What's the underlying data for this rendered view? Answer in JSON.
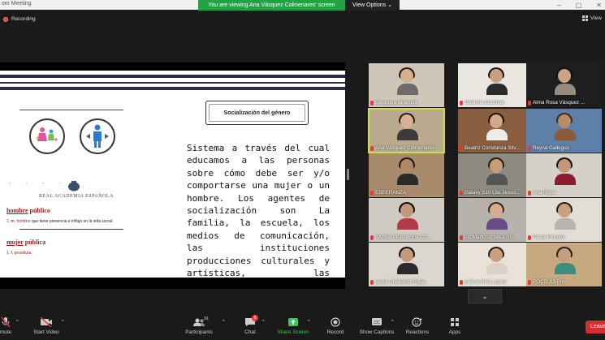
{
  "window": {
    "title": "om Meeting",
    "controls": [
      "–",
      "▢",
      "✕"
    ]
  },
  "banner": {
    "viewing_text": "You are viewing Ana Vásquez Colmenares' screen",
    "view_options": "View Options ⌄"
  },
  "recording_label": "Recording",
  "view_label": "View",
  "slide": {
    "box_title": "Socialización del género",
    "body": "Sistema a través del cual educamos a las personas sobre cómo debe ser y/o comportarse una mujer o un hombre. Los agentes de socialización son La familia, la escuela, los medios de comunicación, las instituciones producciones culturales y artísticas, las tradiciones religiosas, l",
    "rae": "REAL ACADEMIA ESPAÑOLA",
    "dots": "· · · · ·",
    "term1": "hombre público",
    "term1_word1": "hombre",
    "term1_word2": " público",
    "def1_num": "1.",
    "def1_pos": " m. ",
    "def1_red": "hombre",
    "def1_rest": " que tiene presencia e influjo en la vida social.",
    "term2_word1": "mujer",
    "term2_word2": " pública",
    "def2_num": "1.",
    "def2_pos": " f. ",
    "def2_red": "prostituta."
  },
  "participants": [
    {
      "name": "Georgina delarosa",
      "hair": "#2b1a12",
      "skin": "#d4b08c",
      "bg": "#cfc6b8",
      "shirt": "#6b6b6b"
    },
    {
      "name": "Gabriela Guzmán",
      "hair": "#1e1410",
      "skin": "#c9a07f",
      "bg": "#e9e5df",
      "shirt": "#2a2a2a"
    },
    {
      "name": "Alma Rosa Vásquez ...",
      "hair": "#111111",
      "skin": "#caa48a",
      "bg": "#1e1e1e",
      "shirt": "#9a8a7a"
    },
    {
      "name": "Ana Vásquez Colmenares",
      "hair": "#2a1a12",
      "skin": "#d7b095",
      "bg": "#b9a98e",
      "shirt": "#3b3b3b"
    },
    {
      "name": "Beatriz Constanza Silv...",
      "hair": "#1a120e",
      "skin": "#d2a98a",
      "bg": "#8a5f40",
      "shirt": "#ececec"
    },
    {
      "name": "Reyna Gallegos",
      "hair": "#3b2a1e",
      "skin": "#b98b6b",
      "bg": "#5e7fa8",
      "shirt": "#8a5a3a"
    },
    {
      "name": "ESPERANZA",
      "hair": "#1a1a1a",
      "skin": "#b48764",
      "bg": "#a88a6c",
      "shirt": "#2a2a2a"
    },
    {
      "name": "Galaxy S10 Lite Jessic...",
      "hair": "#2a1a10",
      "skin": "#c79c7b",
      "bg": "#8f8a80",
      "shirt": "#555555"
    },
    {
      "name": "Ana Rojas",
      "hair": "#151010",
      "skin": "#c29777",
      "bg": "#d6d1c8",
      "shirt": "#8b1c2b"
    },
    {
      "name": "KARLA MORALES CO...",
      "hair": "#0f0a08",
      "skin": "#c39879",
      "bg": "#cfcac2",
      "shirt": "#b23a48"
    },
    {
      "name": "Lic.Maricruz Silva Ro...",
      "hair": "#3a2818",
      "skin": "#d5ad8e",
      "bg": "#b7b2ab",
      "shirt": "#6a4a8a"
    },
    {
      "name": "Paola Rendón",
      "hair": "#2a1a14",
      "skin": "#c8a182",
      "bg": "#e2ddd6",
      "shirt": "#b8b3ad"
    },
    {
      "name": "Leyla Gualberto Rojas",
      "hair": "#121010",
      "skin": "#c49a7a",
      "bg": "#dcd7ce",
      "shirt": "#2a2a2a"
    },
    {
      "name": "Liliana Ríos López",
      "hair": "#2b1c14",
      "skin": "#caa080",
      "bg": "#e8e2d8",
      "shirt": "#d9d2c4"
    },
    {
      "name": "POCO X3 Pro",
      "hair": "#2a1e16",
      "skin": "#c59d80",
      "bg": "#c7a97f",
      "shirt": "#3a8f7a"
    }
  ],
  "toolbar": {
    "mute": "mute",
    "start_video": "Start Video",
    "participants": "Participants",
    "participants_count": "91",
    "chat": "Chat",
    "chat_badge": "8",
    "share_screen": "Share Screen",
    "record": "Record",
    "show_captions": "Show Captions",
    "reactions": "Reactions",
    "apps": "Apps",
    "leave": "Leave"
  },
  "colors": {
    "banner_green": "#23a243",
    "share_green": "#3fc15b",
    "active_border": "#c9e04a",
    "leave_red": "#d32f2f",
    "slide_stripe": "#2e2a4f",
    "rae_red": "#9a1b1b"
  }
}
